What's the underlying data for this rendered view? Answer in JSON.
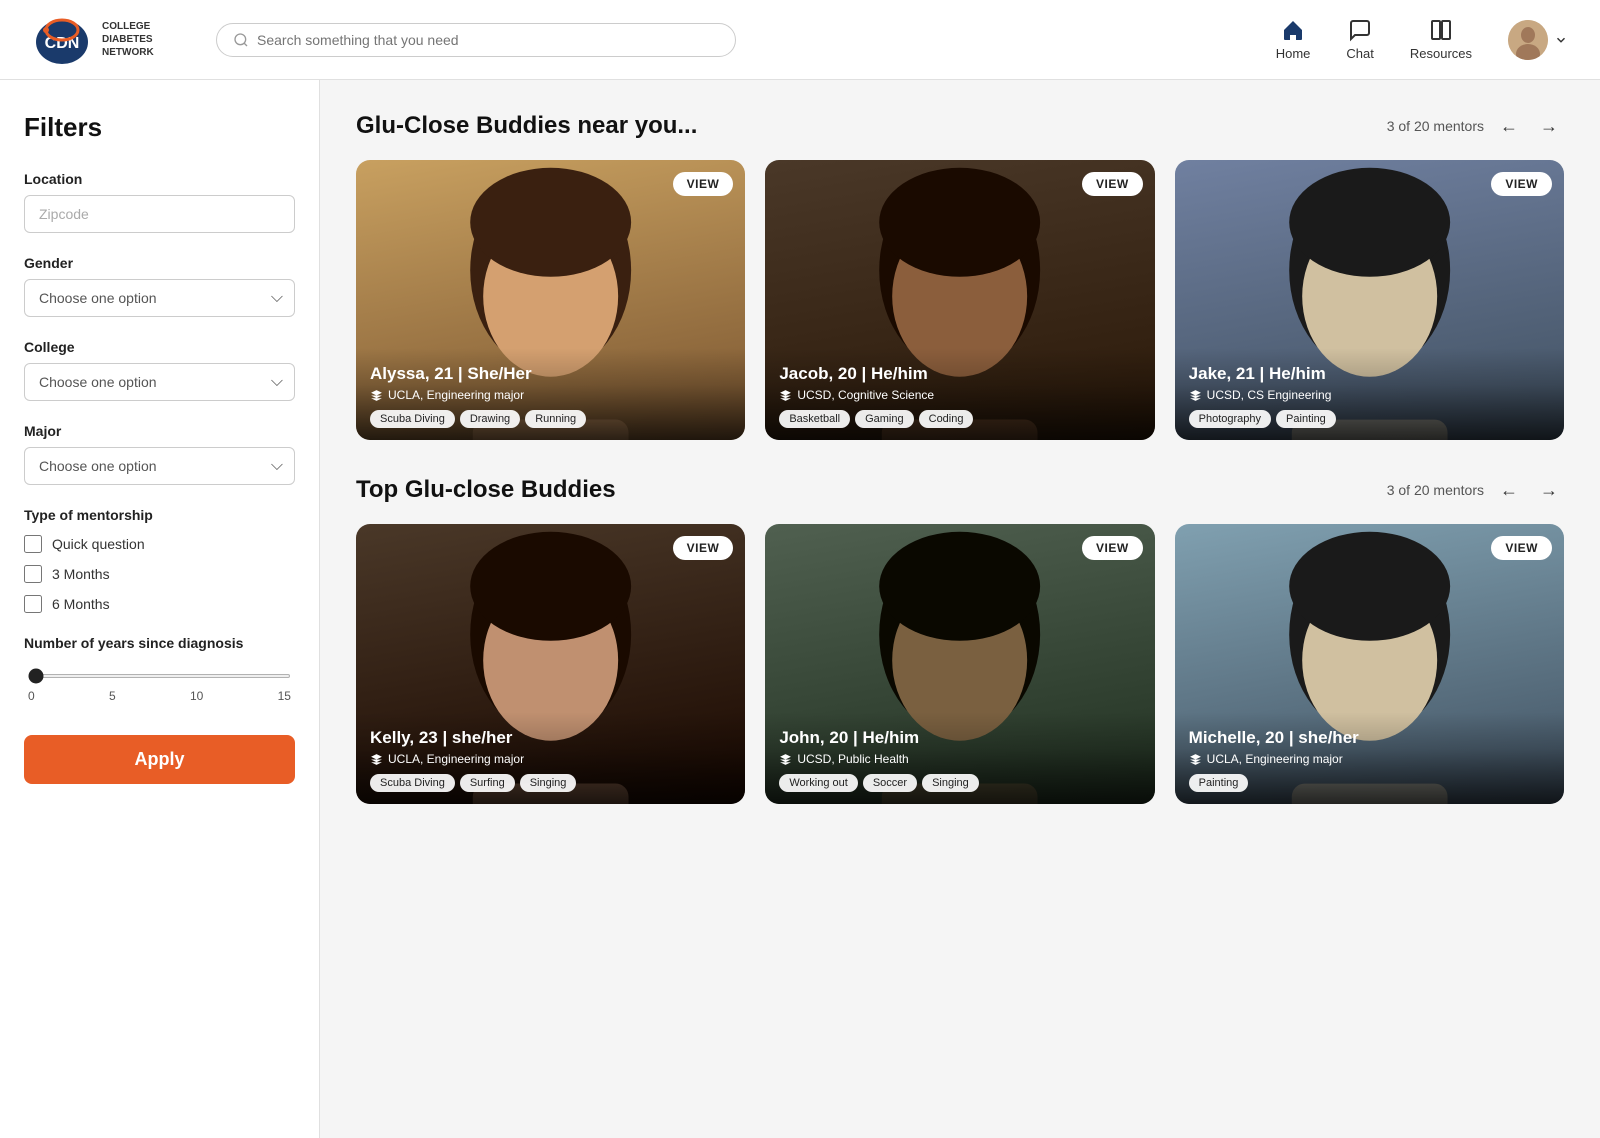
{
  "header": {
    "logo_abbr": "CDN",
    "logo_tagline": "College\nDiabetes\nNetwork",
    "search_placeholder": "Search something that you need",
    "nav": [
      {
        "id": "home",
        "label": "Home",
        "icon": "home"
      },
      {
        "id": "chat",
        "label": "Chat",
        "icon": "chat"
      },
      {
        "id": "resources",
        "label": "Resources",
        "icon": "book"
      }
    ]
  },
  "sidebar": {
    "title": "Filters",
    "location_label": "Location",
    "location_placeholder": "Zipcode",
    "gender_label": "Gender",
    "gender_placeholder": "Choose one option",
    "college_label": "College",
    "college_placeholder": "Choose one option",
    "major_label": "Major",
    "major_placeholder": "Choose one option",
    "mentorship_title": "Type of mentorship",
    "mentorship_options": [
      {
        "id": "quick",
        "label": "Quick question",
        "checked": false
      },
      {
        "id": "3months",
        "label": "3 Months",
        "checked": false
      },
      {
        "id": "6months",
        "label": "6 Months",
        "checked": false
      }
    ],
    "diagnosis_title": "Number of years since diagnosis",
    "slider_min": 0,
    "slider_max": 15,
    "slider_value": 0,
    "slider_labels": [
      "0",
      "5",
      "10",
      "15"
    ],
    "apply_label": "Apply"
  },
  "near_you": {
    "title": "Glu-Close Buddies near you...",
    "pagination": "3 of 20 mentors",
    "mentors": [
      {
        "id": "alyssa",
        "name": "Alyssa, 21 | She/Her",
        "school": "UCLA, Engineering major",
        "tags": [
          "Scuba Diving",
          "Drawing",
          "Running"
        ],
        "card_class": "card-alyssa",
        "view_label": "VIEW"
      },
      {
        "id": "jacob",
        "name": "Jacob, 20 | He/him",
        "school": "UCSD, Cognitive Science",
        "tags": [
          "Basketball",
          "Gaming",
          "Coding"
        ],
        "card_class": "card-jacob",
        "view_label": "VIEW"
      },
      {
        "id": "jake",
        "name": "Jake, 21 | He/him",
        "school": "UCSD, CS Engineering",
        "tags": [
          "Photography",
          "Painting"
        ],
        "card_class": "card-jake",
        "view_label": "VIEW"
      }
    ]
  },
  "top_buddies": {
    "title": "Top Glu-close Buddies",
    "pagination": "3 of 20 mentors",
    "mentors": [
      {
        "id": "kelly",
        "name": "Kelly, 23 | she/her",
        "school": "UCLA, Engineering major",
        "tags": [
          "Scuba Diving",
          "Surfing",
          "Singing"
        ],
        "card_class": "card-kelly",
        "view_label": "VIEW"
      },
      {
        "id": "john",
        "name": "John, 20 | He/him",
        "school": "UCSD, Public Health",
        "tags": [
          "Working out",
          "Soccer",
          "Singing"
        ],
        "card_class": "card-john",
        "view_label": "VIEW"
      },
      {
        "id": "michelle",
        "name": "Michelle, 20 | she/her",
        "school": "UCLA, Engineering major",
        "tags": [
          "Painting"
        ],
        "card_class": "card-michelle",
        "view_label": "VIEW"
      }
    ]
  }
}
